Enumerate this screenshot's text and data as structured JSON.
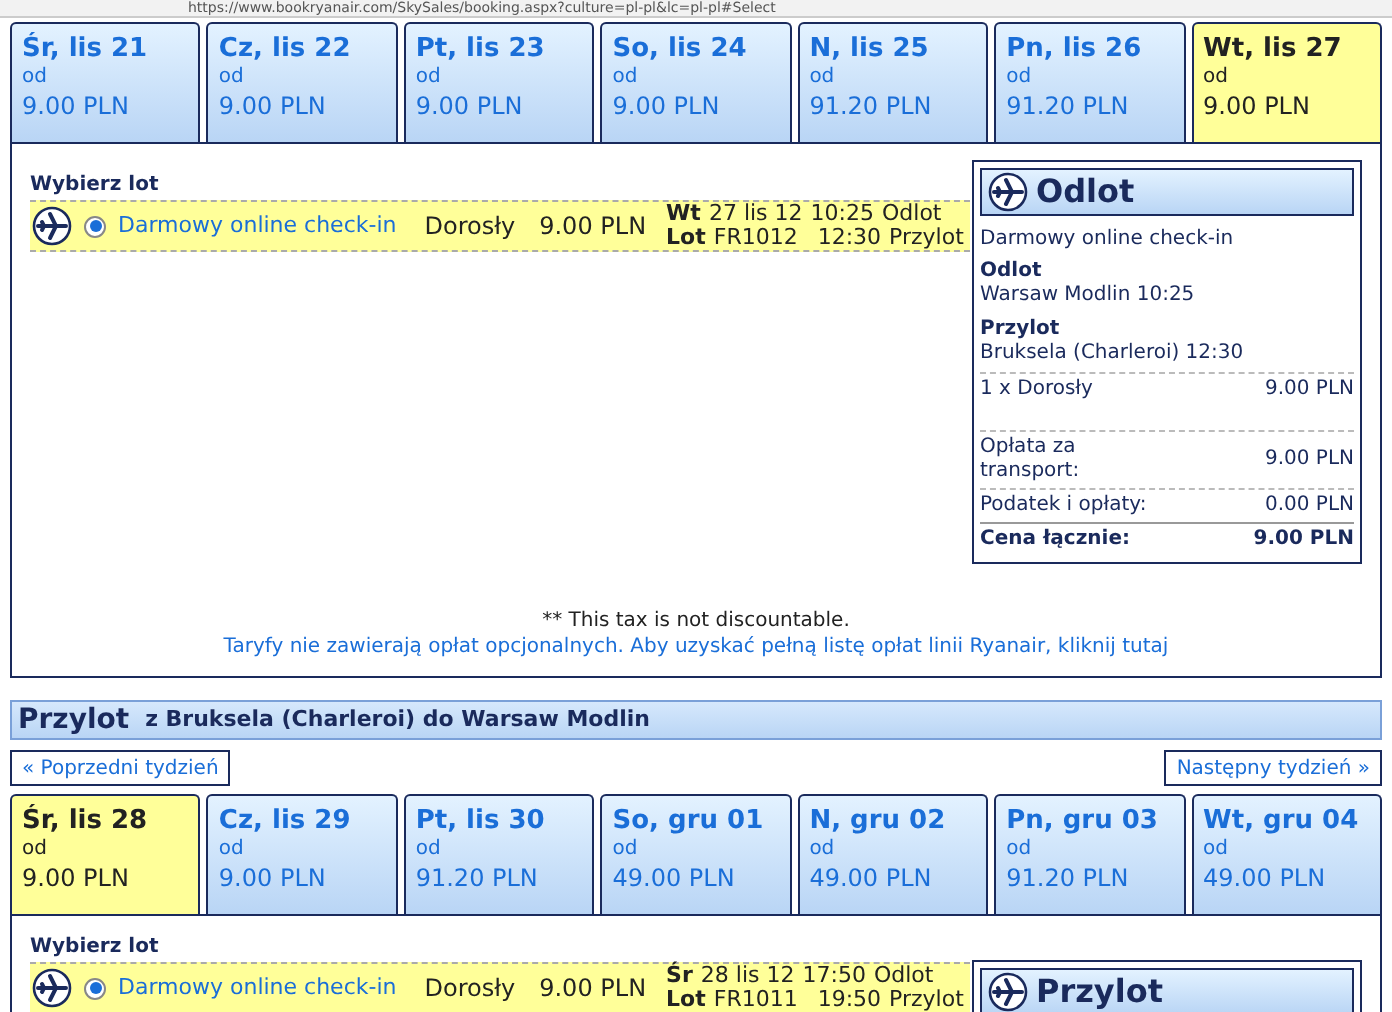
{
  "browser": {
    "url": "https://www.bookryanair.com/SkySales/booking.aspx?culture=pl-pl&lc=pl-pl#Select"
  },
  "outbound": {
    "days": [
      {
        "day": "Śr, lis 21",
        "from": "od",
        "price": "9.00 PLN",
        "selected": false
      },
      {
        "day": "Cz, lis 22",
        "from": "od",
        "price": "9.00 PLN",
        "selected": false
      },
      {
        "day": "Pt, lis 23",
        "from": "od",
        "price": "9.00 PLN",
        "selected": false
      },
      {
        "day": "So, lis 24",
        "from": "od",
        "price": "9.00 PLN",
        "selected": false
      },
      {
        "day": "N, lis 25",
        "from": "od",
        "price": "91.20 PLN",
        "selected": false
      },
      {
        "day": "Pn, lis 26",
        "from": "od",
        "price": "91.20 PLN",
        "selected": false
      },
      {
        "day": "Wt, lis 27",
        "from": "od",
        "price": "9.00 PLN",
        "selected": true
      }
    ],
    "select_label": "Wybierz lot",
    "flights": [
      {
        "selected": true,
        "fare": "Darmowy online check-in",
        "passenger": "Dorosły",
        "price": "9.00 PLN",
        "day_label": "Wt",
        "date": "27 lis 12",
        "flight_label": "Lot",
        "flight_no": "FR1012",
        "dep_time": "10:25",
        "dep_label": "Odlot",
        "arr_time": "12:30",
        "arr_label": "Przylot"
      }
    ],
    "summary": {
      "title": "Odlot",
      "fare": "Darmowy online check-in",
      "dep_label": "Odlot",
      "dep": "Warsaw Modlin 10:25",
      "arr_label": "Przylot",
      "arr": "Bruksela (Charleroi) 12:30",
      "lines": [
        {
          "label": "1 x Dorosły",
          "value": "9.00 PLN",
          "bold": false
        },
        {
          "label": "Opłata za transport:",
          "value": "9.00 PLN",
          "bold": false
        },
        {
          "label": "Podatek i opłaty:",
          "value": "0.00 PLN",
          "bold": false
        },
        {
          "label": "Cena łącznie:",
          "value": "9.00 PLN",
          "bold": true
        }
      ]
    },
    "tax_note": "** This tax is not discountable.",
    "fees_link": "Taryfy nie zawierają opłat opcjonalnych. Aby uzyskać pełną listę opłat linii Ryanair, kliknij tutaj"
  },
  "inbound": {
    "title": "Przylot",
    "route": "z Bruksela (Charleroi) do Warsaw Modlin",
    "prev": "« Poprzedni tydzień",
    "next": "Następny tydzień »",
    "days": [
      {
        "day": "Śr, lis 28",
        "from": "od",
        "price": "9.00 PLN",
        "selected": true
      },
      {
        "day": "Cz, lis 29",
        "from": "od",
        "price": "9.00 PLN",
        "selected": false
      },
      {
        "day": "Pt, lis 30",
        "from": "od",
        "price": "91.20 PLN",
        "selected": false
      },
      {
        "day": "So, gru 01",
        "from": "od",
        "price": "49.00 PLN",
        "selected": false
      },
      {
        "day": "N, gru 02",
        "from": "od",
        "price": "49.00 PLN",
        "selected": false
      },
      {
        "day": "Pn, gru 03",
        "from": "od",
        "price": "91.20 PLN",
        "selected": false
      },
      {
        "day": "Wt, gru 04",
        "from": "od",
        "price": "49.00 PLN",
        "selected": false
      }
    ],
    "select_label": "Wybierz lot",
    "flights": [
      {
        "selected": true,
        "fare": "Darmowy online check-in",
        "passenger": "Dorosły",
        "price": "9.00 PLN",
        "day_label": "Śr",
        "date": "28 lis 12",
        "flight_label": "Lot",
        "flight_no": "FR1011",
        "dep_time": "17:50",
        "dep_label": "Odlot",
        "arr_time": "19:50",
        "arr_label": "Przylot"
      }
    ],
    "summary": {
      "title": "Przylot"
    }
  }
}
